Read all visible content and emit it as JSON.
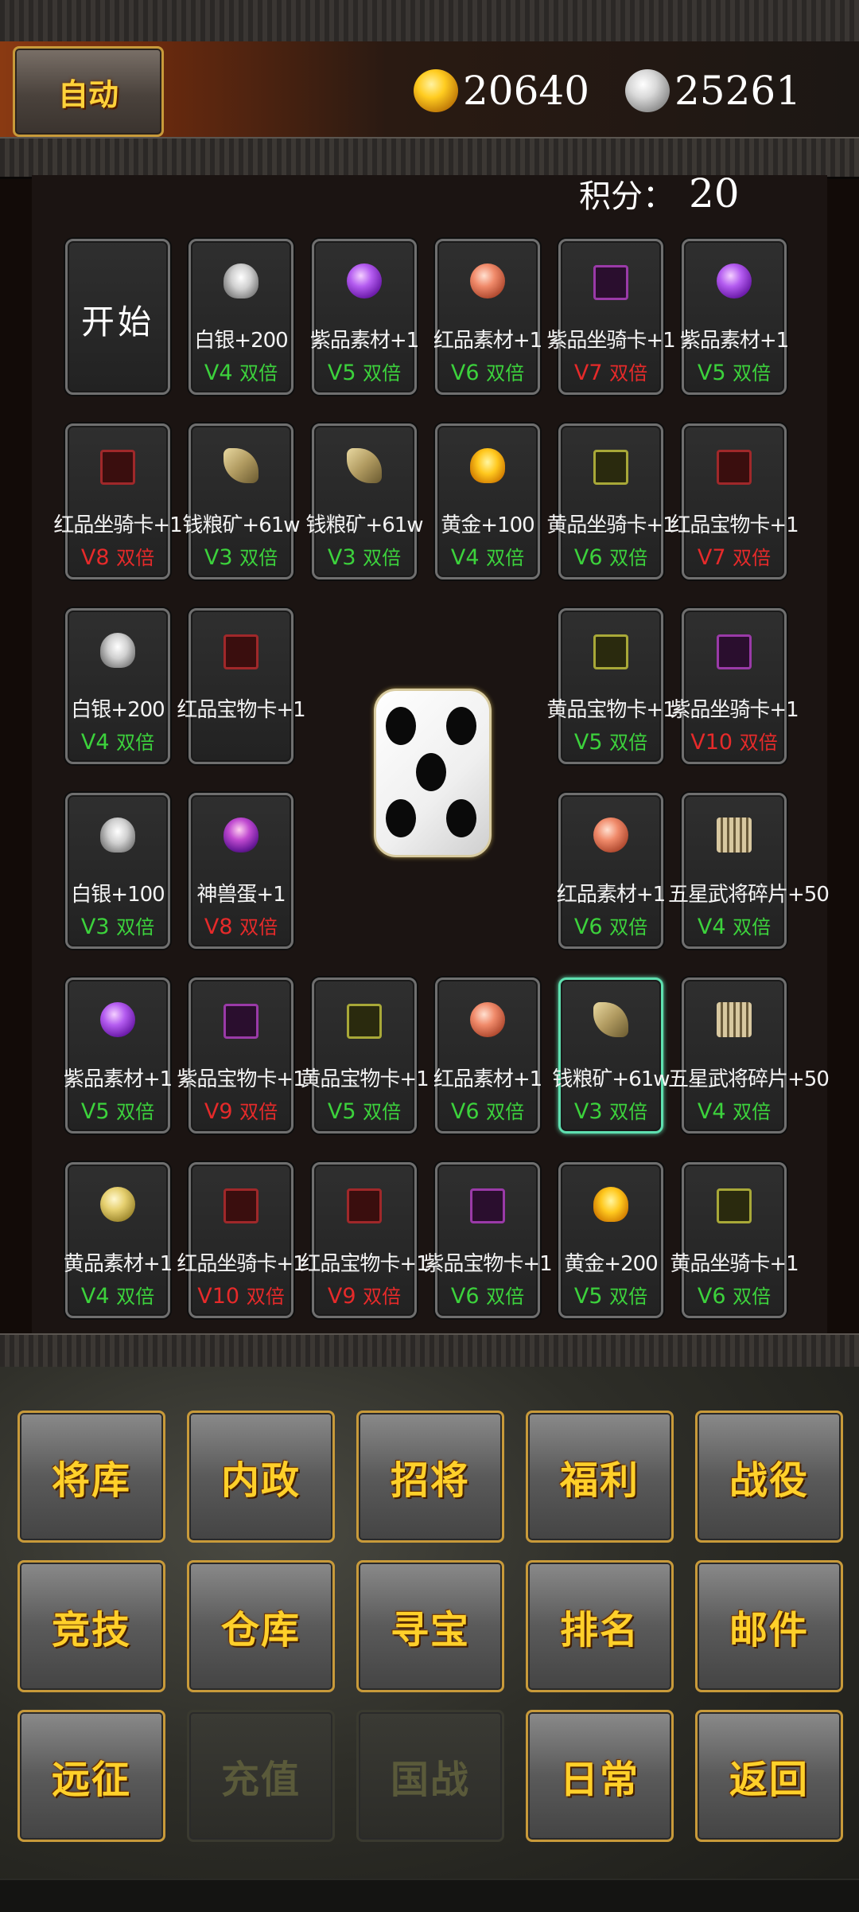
{
  "header": {
    "auto_label": "自动",
    "gold": "20640",
    "silver": "25261",
    "score_label": "积分：",
    "score_value": "20"
  },
  "board": {
    "start_label": "开始",
    "dice_face": 5,
    "cells": [
      {
        "icon": "silver-ingot",
        "name": "白银+200",
        "level": "V4",
        "suffix": "双倍",
        "color": "green"
      },
      {
        "icon": "purple-gem",
        "name": "紫品素材+1",
        "level": "V5",
        "suffix": "双倍",
        "color": "green"
      },
      {
        "icon": "red-gem",
        "name": "红品素材+1",
        "level": "V6",
        "suffix": "双倍",
        "color": "green"
      },
      {
        "icon": "purple-card",
        "name": "紫品坐骑卡+1",
        "level": "V7",
        "suffix": "双倍",
        "color": "red"
      },
      {
        "icon": "purple-gem",
        "name": "紫品素材+1",
        "level": "V5",
        "suffix": "双倍",
        "color": "green"
      },
      {
        "icon": "red-card",
        "name": "红品坐骑卡+1",
        "level": "V8",
        "suffix": "双倍",
        "color": "red"
      },
      {
        "icon": "grain-ore",
        "name": "钱粮矿+61w",
        "level": "V3",
        "suffix": "双倍",
        "color": "green"
      },
      {
        "icon": "grain-ore",
        "name": "钱粮矿+61w",
        "level": "V3",
        "suffix": "双倍",
        "color": "green"
      },
      {
        "icon": "gold-ingot",
        "name": "黄金+100",
        "level": "V4",
        "suffix": "双倍",
        "color": "green"
      },
      {
        "icon": "yellow-card",
        "name": "黄品坐骑卡+1",
        "level": "V6",
        "suffix": "双倍",
        "color": "green"
      },
      {
        "icon": "red-card",
        "name": "红品宝物卡+1",
        "level": "V7",
        "suffix": "双倍",
        "color": "red"
      },
      {
        "icon": "silver-ingot",
        "name": "白银+200",
        "level": "V4",
        "suffix": "双倍",
        "color": "green"
      },
      {
        "icon": "red-card",
        "name": "红品宝物卡+1",
        "level": "",
        "suffix": "",
        "color": "green"
      },
      {
        "icon": "yellow-card",
        "name": "黄品宝物卡+1",
        "level": "V5",
        "suffix": "双倍",
        "color": "green"
      },
      {
        "icon": "purple-card",
        "name": "紫品坐骑卡+1",
        "level": "V10",
        "suffix": "双倍",
        "color": "red"
      },
      {
        "icon": "silver-ingot",
        "name": "白银+100",
        "level": "V3",
        "suffix": "双倍",
        "color": "green"
      },
      {
        "icon": "beast-egg",
        "name": "神兽蛋+1",
        "level": "V8",
        "suffix": "双倍",
        "color": "red"
      },
      {
        "icon": "red-gem",
        "name": "红品素材+1",
        "level": "V6",
        "suffix": "双倍",
        "color": "green"
      },
      {
        "icon": "general-fragment",
        "name": "五星武将碎片+50",
        "level": "V4",
        "suffix": "双倍",
        "color": "green"
      },
      {
        "icon": "purple-gem",
        "name": "紫品素材+1",
        "level": "V5",
        "suffix": "双倍",
        "color": "green"
      },
      {
        "icon": "purple-card",
        "name": "紫品宝物卡+1",
        "level": "V9",
        "suffix": "双倍",
        "color": "red"
      },
      {
        "icon": "yellow-card",
        "name": "黄品宝物卡+1",
        "level": "V5",
        "suffix": "双倍",
        "color": "green"
      },
      {
        "icon": "red-gem",
        "name": "红品素材+1",
        "level": "V6",
        "suffix": "双倍",
        "color": "green"
      },
      {
        "icon": "grain-ore",
        "name": "钱粮矿+61w",
        "level": "V3",
        "suffix": "双倍",
        "color": "green"
      },
      {
        "icon": "general-fragment",
        "name": "五星武将碎片+50",
        "level": "V4",
        "suffix": "双倍",
        "color": "green"
      },
      {
        "icon": "yellow-gem",
        "name": "黄品素材+1",
        "level": "V4",
        "suffix": "双倍",
        "color": "green"
      },
      {
        "icon": "red-card",
        "name": "红品坐骑卡+1",
        "level": "V10",
        "suffix": "双倍",
        "color": "red"
      },
      {
        "icon": "red-card",
        "name": "红品宝物卡+1",
        "level": "V9",
        "suffix": "双倍",
        "color": "red"
      },
      {
        "icon": "purple-card",
        "name": "紫品宝物卡+1",
        "level": "V6",
        "suffix": "双倍",
        "color": "green"
      },
      {
        "icon": "gold-ingot",
        "name": "黄金+200",
        "level": "V5",
        "suffix": "双倍",
        "color": "green"
      },
      {
        "icon": "yellow-card",
        "name": "黄品坐骑卡+1",
        "level": "V6",
        "suffix": "双倍",
        "color": "green"
      }
    ]
  },
  "menu": [
    {
      "label": "将库",
      "enabled": true
    },
    {
      "label": "内政",
      "enabled": true
    },
    {
      "label": "招将",
      "enabled": true
    },
    {
      "label": "福利",
      "enabled": true
    },
    {
      "label": "战役",
      "enabled": true
    },
    {
      "label": "竞技",
      "enabled": true
    },
    {
      "label": "仓库",
      "enabled": true
    },
    {
      "label": "寻宝",
      "enabled": true
    },
    {
      "label": "排名",
      "enabled": true
    },
    {
      "label": "邮件",
      "enabled": true
    },
    {
      "label": "远征",
      "enabled": true
    },
    {
      "label": "充值",
      "enabled": false
    },
    {
      "label": "国战",
      "enabled": false
    },
    {
      "label": "日常",
      "enabled": true
    },
    {
      "label": "返回",
      "enabled": true
    }
  ],
  "colors": {
    "green": "#3cd23c",
    "red": "#e62a2a",
    "accent_gold": "#ffd02a",
    "selected": "#5fe0b0"
  }
}
